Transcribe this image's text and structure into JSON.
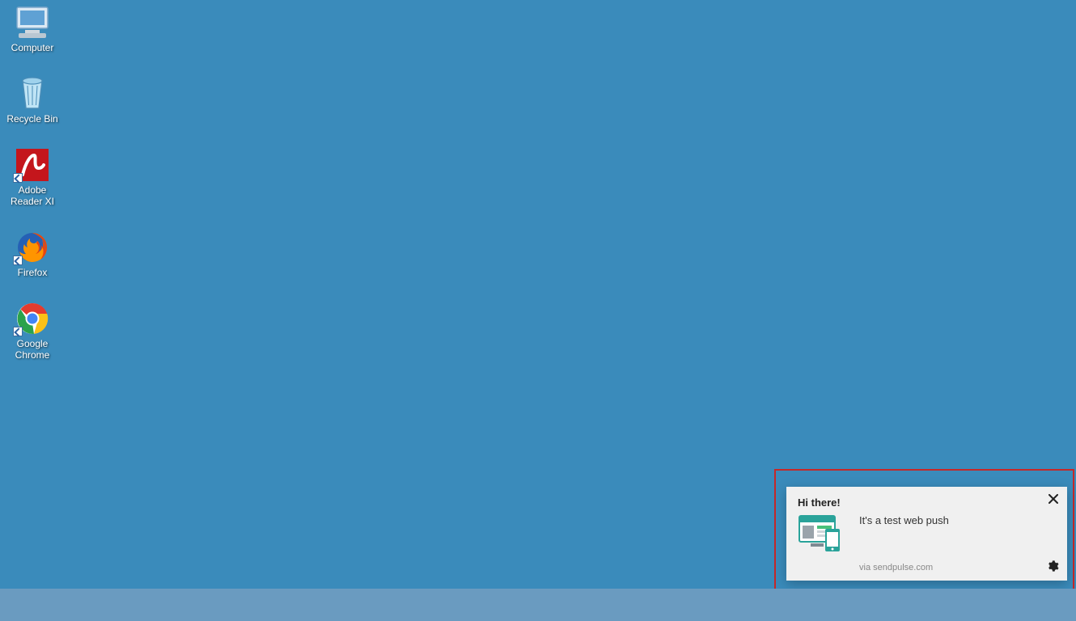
{
  "desktop": {
    "background_color": "#3a8bbb",
    "icons": [
      {
        "id": "computer",
        "label": "Computer",
        "shortcut": false
      },
      {
        "id": "recycle-bin",
        "label": "Recycle Bin",
        "shortcut": false
      },
      {
        "id": "adobe-reader",
        "label": "Adobe\nReader XI",
        "shortcut": true
      },
      {
        "id": "firefox",
        "label": "Firefox",
        "shortcut": true
      },
      {
        "id": "google-chrome",
        "label": "Google\nChrome",
        "shortcut": true
      }
    ]
  },
  "notification": {
    "title": "Hi there!",
    "body": "It's a test web push",
    "via": "via sendpulse.com",
    "highlight_color": "#c62828"
  }
}
